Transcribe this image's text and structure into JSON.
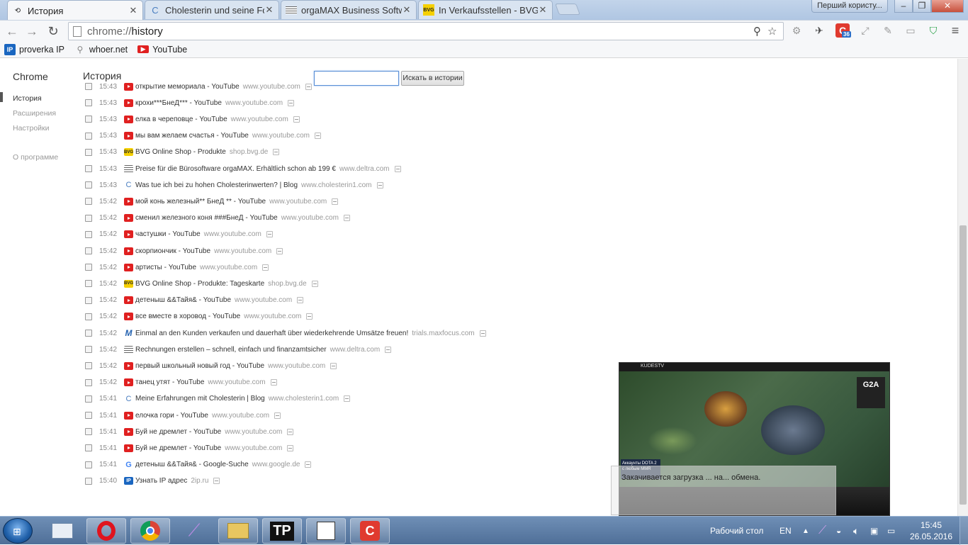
{
  "tabs": [
    {
      "title": "История",
      "icon": "history-icon",
      "active": true
    },
    {
      "title": "Cholesterin und seine Fol",
      "icon": "cholesterin-favicon",
      "active": false
    },
    {
      "title": "orgaMAX Business Softwa",
      "icon": "deltra-favicon",
      "active": false
    },
    {
      "title": "In Verkaufsstellen - BVG.d",
      "icon": "bvg-favicon",
      "active": false
    }
  ],
  "window": {
    "user_label": "Перший користу..."
  },
  "omnibox": {
    "scheme": "chrome://",
    "path": "history"
  },
  "bookmarks": [
    {
      "label": "proverka IP",
      "icon": "IP"
    },
    {
      "label": "whoer.net",
      "icon": "search"
    },
    {
      "label": "YouTube",
      "icon": "youtube"
    }
  ],
  "sidebar": {
    "brand": "Chrome",
    "items": [
      {
        "label": "История",
        "selected": true
      },
      {
        "label": "Расширения",
        "selected": false
      },
      {
        "label": "Настройки",
        "selected": false
      }
    ],
    "about": "О программе"
  },
  "main": {
    "heading": "История",
    "search_button": "Искать в истории",
    "search_value": ""
  },
  "history": [
    {
      "time": "15:43",
      "icon": "yt",
      "title": "открытие мемориала - YouTube",
      "domain": "www.youtube.com"
    },
    {
      "time": "15:43",
      "icon": "yt",
      "title": "крохи***БнеД*** - YouTube",
      "domain": "www.youtube.com"
    },
    {
      "time": "15:43",
      "icon": "yt",
      "title": "елка в череповце - YouTube",
      "domain": "www.youtube.com"
    },
    {
      "time": "15:43",
      "icon": "yt",
      "title": "мы вам желаем счастья - YouTube",
      "domain": "www.youtube.com"
    },
    {
      "time": "15:43",
      "icon": "bvg",
      "title": "BVG Online Shop - Produkte",
      "domain": "shop.bvg.de"
    },
    {
      "time": "15:43",
      "icon": "dl",
      "title": "Preise für die Bürosoftware orgaMAX. Erhältlich schon ab 199 €",
      "domain": "www.deltra.com"
    },
    {
      "time": "15:43",
      "icon": "ch",
      "title": "Was tue ich bei zu hohen Cholesterinwerten? | Blog",
      "domain": "www.cholesterin1.com"
    },
    {
      "time": "15:42",
      "icon": "yt",
      "title": "мой конь железный** БнеД ** - YouTube",
      "domain": "www.youtube.com"
    },
    {
      "time": "15:42",
      "icon": "yt",
      "title": "сменил железного коня ###БнеД - YouTube",
      "domain": "www.youtube.com"
    },
    {
      "time": "15:42",
      "icon": "yt",
      "title": "частушки - YouTube",
      "domain": "www.youtube.com"
    },
    {
      "time": "15:42",
      "icon": "yt",
      "title": "скорпиончик - YouTube",
      "domain": "www.youtube.com"
    },
    {
      "time": "15:42",
      "icon": "yt",
      "title": "артисты - YouTube",
      "domain": "www.youtube.com"
    },
    {
      "time": "15:42",
      "icon": "bvg",
      "title": "BVG Online Shop - Produkte: Tageskarte",
      "domain": "shop.bvg.de"
    },
    {
      "time": "15:42",
      "icon": "yt",
      "title": "детеныш &&Тайя& - YouTube",
      "domain": "www.youtube.com"
    },
    {
      "time": "15:42",
      "icon": "yt",
      "title": "все вместе в хоровод - YouTube",
      "domain": "www.youtube.com"
    },
    {
      "time": "15:42",
      "icon": "mx",
      "title": "Einmal an den Kunden verkaufen und dauerhaft über wiederkehrende Umsätze freuen!",
      "domain": "trials.maxfocus.com"
    },
    {
      "time": "15:42",
      "icon": "dl",
      "title": "Rechnungen erstellen – schnell, einfach und finanzamtsicher",
      "domain": "www.deltra.com"
    },
    {
      "time": "15:42",
      "icon": "yt",
      "title": "первый школьный новый год - YouTube",
      "domain": "www.youtube.com"
    },
    {
      "time": "15:42",
      "icon": "yt",
      "title": "танец утят - YouTube",
      "domain": "www.youtube.com"
    },
    {
      "time": "15:41",
      "icon": "ch",
      "title": "Meine Erfahrungen mit Cholesterin | Blog",
      "domain": "www.cholesterin1.com"
    },
    {
      "time": "15:41",
      "icon": "yt",
      "title": "елочка гори - YouTube",
      "domain": "www.youtube.com"
    },
    {
      "time": "15:41",
      "icon": "yt",
      "title": "Буй не дремлет - YouTube",
      "domain": "www.youtube.com"
    },
    {
      "time": "15:41",
      "icon": "yt",
      "title": "Буй не дремлет - YouTube",
      "domain": "www.youtube.com"
    },
    {
      "time": "15:41",
      "icon": "gg",
      "title": "детеныш &&Тайя& - Google-Suche",
      "domain": "www.google.de"
    },
    {
      "time": "15:40",
      "icon": "ip",
      "title": "Узнать IP адрес",
      "domain": "2ip.ru"
    }
  ],
  "overlay": {
    "video_channel": "KUDESTV",
    "video_sponsor": "G2A",
    "video_ad": "Аккаунты DOTA 2 с любым MMR",
    "notification_text": "Закачивается загрузка ... на... обмена."
  },
  "taskbar": {
    "apps": [
      "explorer-icon",
      "opera-icon",
      "chrome-icon",
      "feather-icon",
      "folder-icon",
      "tp-icon",
      "calendar-icon",
      "tool-icon"
    ],
    "desktop_label": "Рабочий стол",
    "lang": "EN",
    "time": "15:45",
    "date": "26.05.2016"
  },
  "badge_count": "36"
}
